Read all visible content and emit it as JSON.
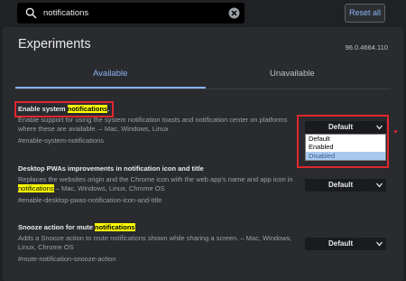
{
  "search": {
    "value": "notifications"
  },
  "reset_label": "Reset all",
  "header": {
    "title": "Experiments",
    "version": "96.0.4664.110"
  },
  "tabs": {
    "available": "Available",
    "unavailable": "Unavailable"
  },
  "experiments": [
    {
      "name_pre": "Enable system ",
      "name_hl": "notifications",
      "name_post": ".",
      "desc_pre": "Enable support for using the system notification toasts and notification center on platforms where these are available. – Mac, Windows, Linux",
      "desc_hl": "",
      "desc_post": "",
      "link": "#enable-system-notifications",
      "select_value": "Default"
    },
    {
      "name_pre": "Desktop PWAs improvements in notification icon and title",
      "name_hl": "",
      "name_post": "",
      "desc_pre": "Replaces the websites origin and the Chrome icon with the web app's name and app icon in ",
      "desc_hl": "notifications",
      "desc_post": " – Mac, Windows, Linux, Chrome OS",
      "link": "#enable-desktop-pwas-notification-icon-and-title",
      "select_value": "Default"
    },
    {
      "name_pre": "Snooze action for mute ",
      "name_hl": "notifications",
      "name_post": "",
      "desc_pre": "Adds a Snooze action to mute notifications shown while sharing a screen. – Mac, Windows, Linux, Chrome OS",
      "desc_hl": "",
      "desc_post": "",
      "link": "#mute-notification-snooze-action",
      "select_value": "Default"
    }
  ],
  "dropdown_options": [
    "Default",
    "Enabled",
    "Disabled"
  ],
  "colors": {
    "accent": "#8ab4f8",
    "highlight": "#ffff00",
    "annotation": "#e0272f",
    "background": "#202124",
    "panel": "#2a2b2e"
  }
}
